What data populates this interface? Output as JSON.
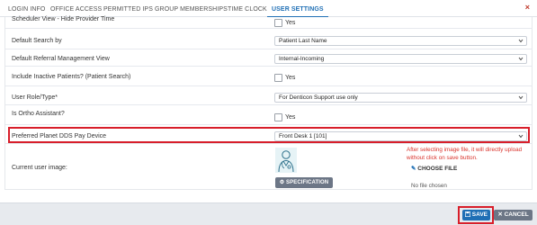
{
  "tabs": [
    {
      "label": "LOGIN INFO",
      "active": false
    },
    {
      "label": "OFFICE ACCESS",
      "active": false
    },
    {
      "label": "PERMITTED IPS",
      "active": false
    },
    {
      "label": "GROUP MEMBERSHIPS",
      "active": false
    },
    {
      "label": "TIME CLOCK",
      "active": false
    },
    {
      "label": "USER SETTINGS",
      "active": true
    }
  ],
  "close_icon": "×",
  "rows": {
    "scheduler_view": {
      "label": "Scheduler View - Hide Provider Time",
      "checkbox_label": "Yes",
      "checked": false
    },
    "default_search": {
      "label": "Default Search by",
      "value": "Patient Last Name"
    },
    "default_referral": {
      "label": "Default Referral Management View",
      "value": "Internal-Incoming"
    },
    "include_inactive": {
      "label": "Include Inactive Patients? (Patient Search)",
      "checkbox_label": "Yes",
      "checked": false
    },
    "user_role": {
      "label": "User Role/Type*",
      "value": "For Denticon Support use only"
    },
    "ortho_assistant": {
      "label": "Is Ortho Assistant?",
      "checkbox_label": "Yes",
      "checked": false
    },
    "pay_device": {
      "label": "Preferred Planet DDS Pay Device",
      "value": "Front Desk 1 [101]"
    },
    "user_image": {
      "label": "Current user image:",
      "note": "After selecting image file, it will directly upload without click on save button.",
      "choose_file_label": "CHOOSE FILE",
      "no_file_label": "No file chosen",
      "specification_label": "SPECIFICATION"
    }
  },
  "footer": {
    "save_label": "SAVE",
    "cancel_label": "CANCEL"
  },
  "colors": {
    "accent": "#1f6fb5",
    "highlight": "#d81e2a",
    "note_text": "#d9322b",
    "secondary_button": "#6c7686",
    "footer_bg": "#e7eaee"
  },
  "icons": {
    "dropdown": "chevron-down-icon",
    "choose_file": "pencil-icon",
    "specification": "gears-icon",
    "save": "floppy-disk-icon",
    "cancel": "close-icon",
    "avatar": "user-doctor-icon"
  }
}
